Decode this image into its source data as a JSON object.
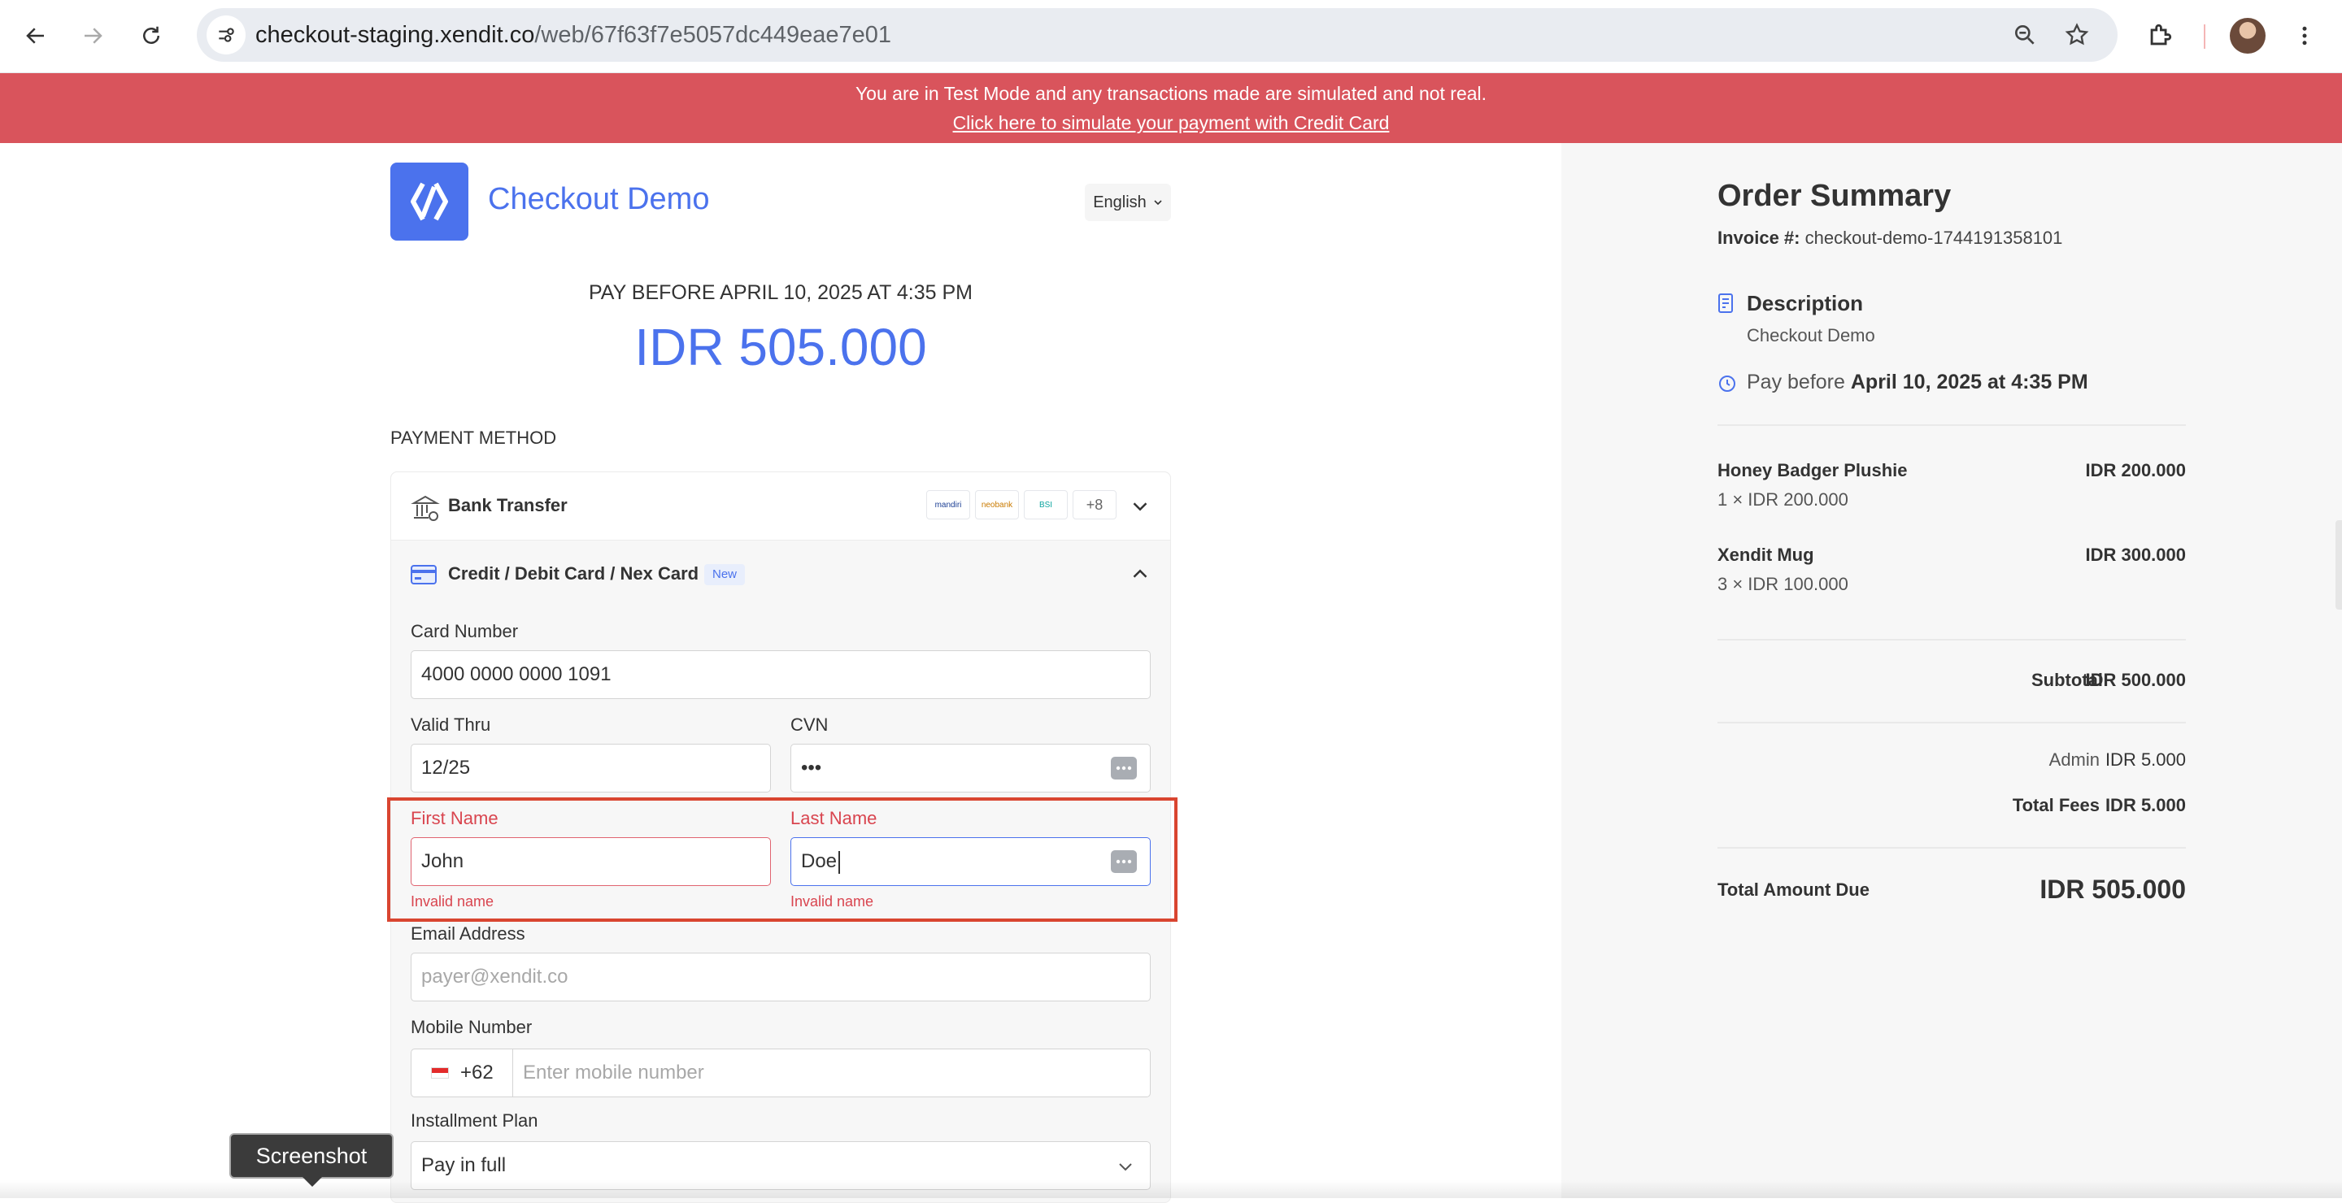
{
  "browser": {
    "url_host": "checkout-staging.xendit.co",
    "url_path": "/web/67f63f7e5057dc449eae7e01"
  },
  "banner": {
    "message": "You are in Test Mode and any transactions made are simulated and not real.",
    "link": "Click here to simulate your payment with Credit Card"
  },
  "header": {
    "brand": "Checkout Demo",
    "language": "English"
  },
  "payment": {
    "pay_before": "PAY BEFORE APRIL 10, 2025 AT 4:35 PM",
    "amount": "IDR 505.000",
    "method_label": "PAYMENT METHOD"
  },
  "methods": {
    "bank_transfer": {
      "label": "Bank Transfer",
      "banks": [
        "mandiri",
        "neobank",
        "BSI"
      ],
      "more": "+8"
    },
    "card": {
      "label": "Credit / Debit Card / Nex Card",
      "badge": "New"
    }
  },
  "form": {
    "card_number_label": "Card Number",
    "card_number": "4000 0000 0000 1091",
    "valid_thru_label": "Valid Thru",
    "valid_thru": "12/25",
    "cvn_label": "CVN",
    "cvn": "•••",
    "first_name_label": "First Name",
    "first_name": "John",
    "first_name_error": "Invalid name",
    "last_name_label": "Last Name",
    "last_name": "Doe",
    "last_name_error": "Invalid name",
    "email_label": "Email Address",
    "email_placeholder": "payer@xendit.co",
    "mobile_label": "Mobile Number",
    "dial_code": "+62",
    "mobile_placeholder": "Enter mobile number",
    "installment_label": "Installment Plan",
    "installment": "Pay in full"
  },
  "summary": {
    "title": "Order Summary",
    "invoice_label": "Invoice #:",
    "invoice": "checkout-demo-1744191358101",
    "description_label": "Description",
    "description": "Checkout Demo",
    "pay_before_prefix": "Pay before",
    "pay_before_date": "April 10, 2025 at 4:35 PM",
    "items": [
      {
        "name": "Honey Badger Plushie",
        "qty": "1 × IDR 200.000",
        "price": "IDR 200.000"
      },
      {
        "name": "Xendit Mug",
        "qty": "3 × IDR 100.000",
        "price": "IDR 300.000"
      }
    ],
    "subtotal_label": "Subtotal",
    "subtotal": "IDR 500.000",
    "admin_label": "Admin",
    "admin": "IDR 5.000",
    "total_fees_label": "Total Fees",
    "total_fees": "IDR 5.000",
    "total_label": "Total Amount Due",
    "total": "IDR 505.000"
  },
  "tooltip": "Screenshot",
  "colors": {
    "brand": "#4b72ed",
    "banner": "#d9545c",
    "error": "#d9454f",
    "highlight": "#d94530"
  }
}
